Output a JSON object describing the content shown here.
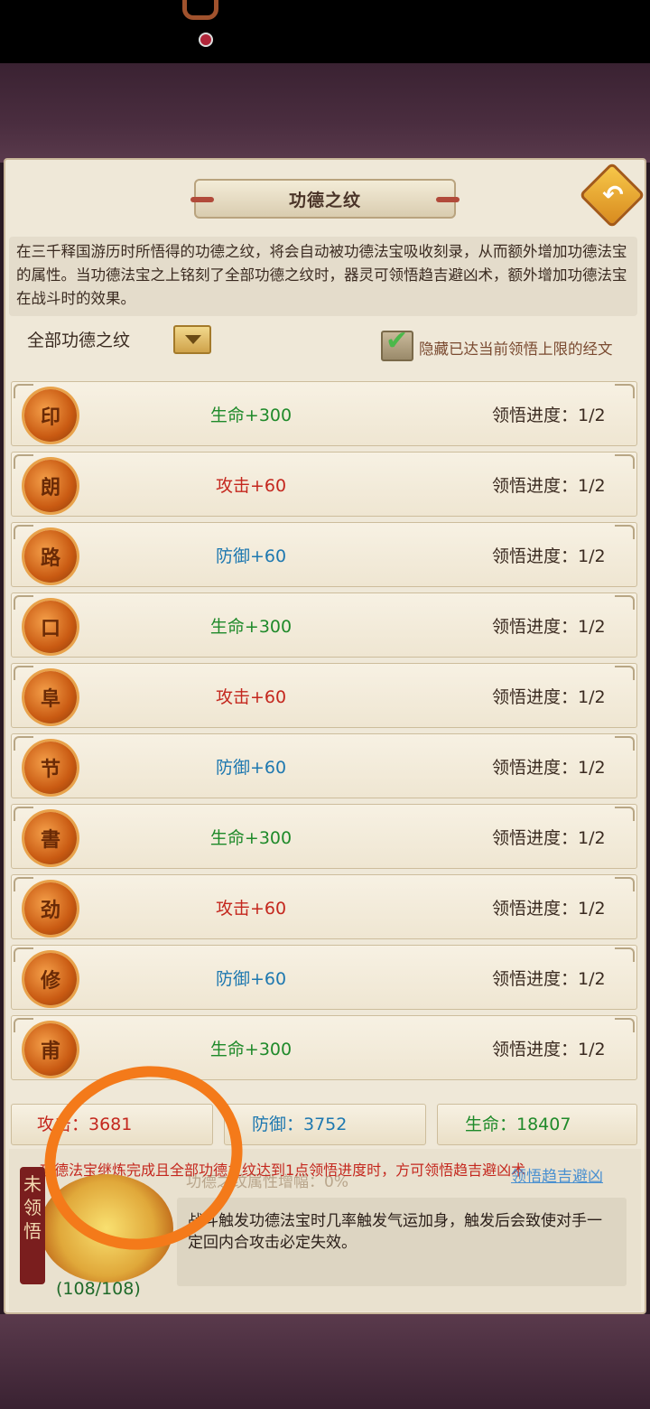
{
  "title": "功德之纹",
  "description": "在三千释国游历时所悟得的功德之纹，将会自动被功德法宝吸收刻录，从而额外增加功德法宝的属性。当功德法宝之上铭刻了全部功德之纹时，器灵可领悟趋吉避凶术，额外增加功德法宝在战斗时的效果。",
  "filter": {
    "selected": "全部功德之纹"
  },
  "hide_option": {
    "label": "隐藏已达当前领悟上限的经文",
    "checked": true
  },
  "rows": [
    {
      "stat": "生命+300",
      "progress": "领悟进度：1/2",
      "glyph": "印"
    },
    {
      "stat": "攻击+60",
      "progress": "领悟进度：1/2",
      "glyph": "朗"
    },
    {
      "stat": "防御+60",
      "progress": "领悟进度：1/2",
      "glyph": "路"
    },
    {
      "stat": "生命+300",
      "progress": "领悟进度：1/2",
      "glyph": "口"
    },
    {
      "stat": "攻击+60",
      "progress": "领悟进度：1/2",
      "glyph": "阜"
    },
    {
      "stat": "防御+60",
      "progress": "领悟进度：1/2",
      "glyph": "节"
    },
    {
      "stat": "生命+300",
      "progress": "领悟进度：1/2",
      "glyph": "書"
    },
    {
      "stat": "攻击+60",
      "progress": "领悟进度：1/2",
      "glyph": "劲"
    },
    {
      "stat": "防御+60",
      "progress": "领悟进度：1/2",
      "glyph": "修"
    },
    {
      "stat": "生命+300",
      "progress": "领悟进度：1/2",
      "glyph": "甫"
    }
  ],
  "totals": {
    "attack": "攻击：3681",
    "defense": "防御：3752",
    "hp": "生命：18407"
  },
  "bottom": {
    "warning": "功德法宝继炼完成且全部功德之纹达到1点领悟进度时，方可领悟趋吉避凶术",
    "sub_label": "功德之纹属性增幅：0%",
    "link": "领悟趋吉避凶",
    "seal": "未领悟",
    "count": "(108/108)",
    "effect": "战斗触发功德法宝时几率触发气运加身，触发后会致使对手一定回内合攻击必定失效。"
  }
}
